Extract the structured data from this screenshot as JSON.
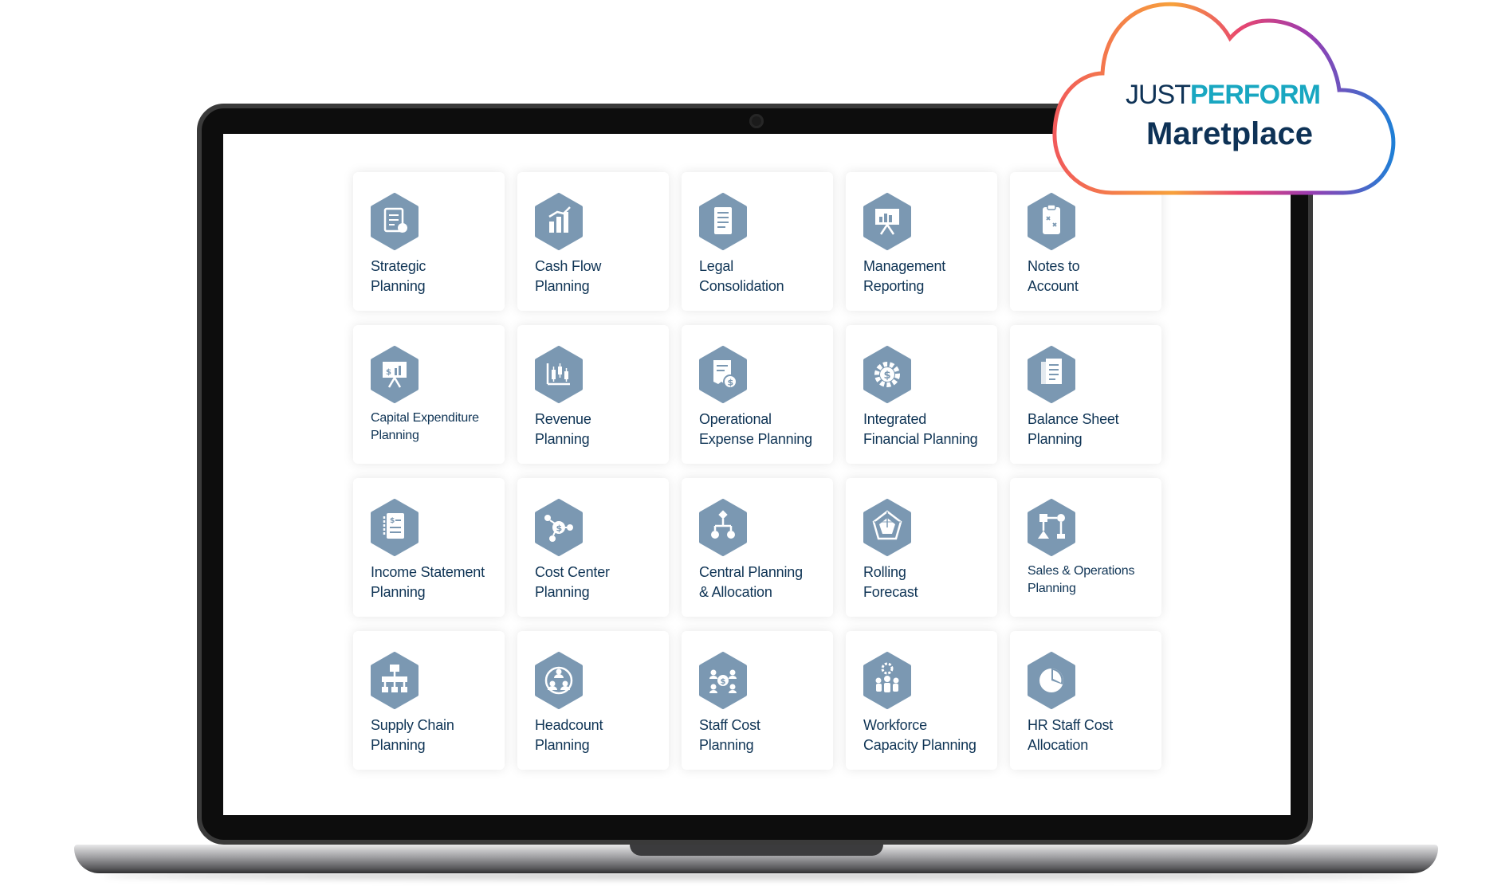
{
  "brand": {
    "just": "JUST",
    "perform": "PERFORM",
    "subtitle": "Maretplace"
  },
  "colors": {
    "icon_fill": "#7b98b2",
    "label": "#0f3455",
    "accent": "#19a7c1",
    "brand_dark": "#0e3256"
  },
  "tiles": [
    {
      "line1": "Strategic",
      "line2": "Planning",
      "icon": "strategy-checklist-icon"
    },
    {
      "line1": "Cash Flow",
      "line2": "Planning",
      "icon": "bar-chart-up-icon"
    },
    {
      "line1": "Legal",
      "line2": "Consolidation",
      "icon": "document-icon"
    },
    {
      "line1": "Management",
      "line2": "Reporting",
      "icon": "presentation-board-icon"
    },
    {
      "line1": "Notes to",
      "line2": "Account",
      "icon": "clipboard-notes-icon"
    },
    {
      "line1": "Capital Expenditure",
      "line2": "Planning",
      "icon": "capex-board-icon",
      "small": true
    },
    {
      "line1": "Revenue",
      "line2": "Planning",
      "icon": "candlestick-chart-icon"
    },
    {
      "line1": "Operational",
      "line2": "Expense Planning",
      "icon": "receipt-dollar-icon"
    },
    {
      "line1": "Integrated",
      "line2": "Financial Planning",
      "icon": "gear-dollar-icon"
    },
    {
      "line1": "Balance Sheet",
      "line2": "Planning",
      "icon": "balance-sheet-icon"
    },
    {
      "line1": "Income Statement",
      "line2": "Planning",
      "icon": "income-statement-icon"
    },
    {
      "line1": "Cost Center",
      "line2": "Planning",
      "icon": "cost-network-icon"
    },
    {
      "line1": "Central Planning",
      "line2": "& Allocation",
      "icon": "hierarchy-icon"
    },
    {
      "line1": "Rolling",
      "line2": "Forecast",
      "icon": "radar-chart-icon"
    },
    {
      "line1": "Sales & Operations",
      "line2": "Planning",
      "icon": "flow-nodes-icon",
      "small": true
    },
    {
      "line1": "Supply Chain",
      "line2": "Planning",
      "icon": "org-chart-icon"
    },
    {
      "line1": "Headcount",
      "line2": "Planning",
      "icon": "people-group-icon"
    },
    {
      "line1": "Staff Cost",
      "line2": "Planning",
      "icon": "staff-cost-icon"
    },
    {
      "line1": "Workforce",
      "line2": "Capacity Planning",
      "icon": "workforce-icon"
    },
    {
      "line1": "HR Staff Cost",
      "line2": "Allocation",
      "icon": "pie-chart-icon"
    }
  ]
}
